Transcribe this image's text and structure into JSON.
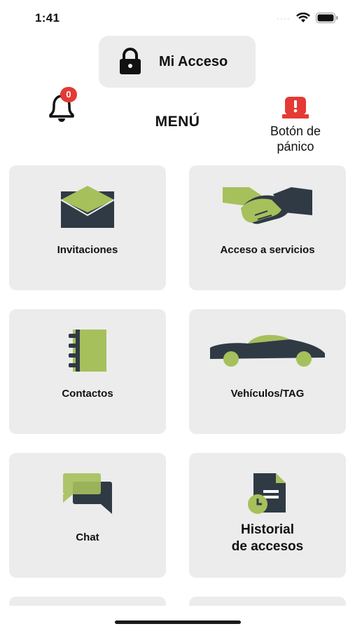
{
  "status_bar": {
    "time": "1:41",
    "signal": "····"
  },
  "header": {
    "access_button_label": "Mi Acceso",
    "notifications_count": "0",
    "menu_title": "MENÚ",
    "panic_button_label": "Botón de pánico"
  },
  "menu": {
    "items": [
      {
        "label": "Invitaciones",
        "icon": "envelope-icon"
      },
      {
        "label": "Acceso a servicios",
        "icon": "handshake-icon"
      },
      {
        "label": "Contactos",
        "icon": "notebook-icon"
      },
      {
        "label": "Vehículos/TAG",
        "icon": "car-icon"
      },
      {
        "label": "Chat",
        "icon": "chat-icon"
      },
      {
        "label": "Historial\nde accesos",
        "icon": "history-document-icon"
      }
    ]
  },
  "colors": {
    "accent_green": "#a6c05c",
    "dark_slate": "#2f3a44",
    "card_bg": "#ececec",
    "alert_red": "#e53935"
  }
}
